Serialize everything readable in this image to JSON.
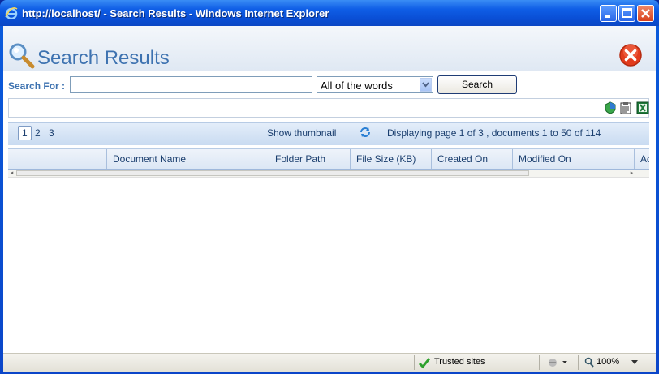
{
  "window": {
    "title": "http://localhost/ - Search Results - Windows Internet Explorer"
  },
  "page": {
    "title": "Search Results"
  },
  "search": {
    "label": "Search For :",
    "value": "",
    "placeholder": "",
    "match_mode": "All of the words",
    "button_label": "Search"
  },
  "toolbar": {
    "icons": [
      "shield-icon",
      "clipboard-icon",
      "excel-icon"
    ]
  },
  "pager": {
    "pages": [
      "1",
      "2",
      "3"
    ],
    "current_page": "1",
    "thumbnail_label": "Show thumbnail",
    "display_text": "Displaying page 1 of 3 , documents 1 to 50 of 114"
  },
  "grid": {
    "columns": [
      "",
      "Document Name",
      "Folder Path",
      "File Size (KB)",
      "Created On",
      "Modified On",
      "Ac"
    ]
  },
  "statusbar": {
    "zone_label": "Trusted sites",
    "zoom_label": "100%"
  },
  "colors": {
    "title_accent": "#3d72b0",
    "window_chrome": "#0a4fd6"
  }
}
